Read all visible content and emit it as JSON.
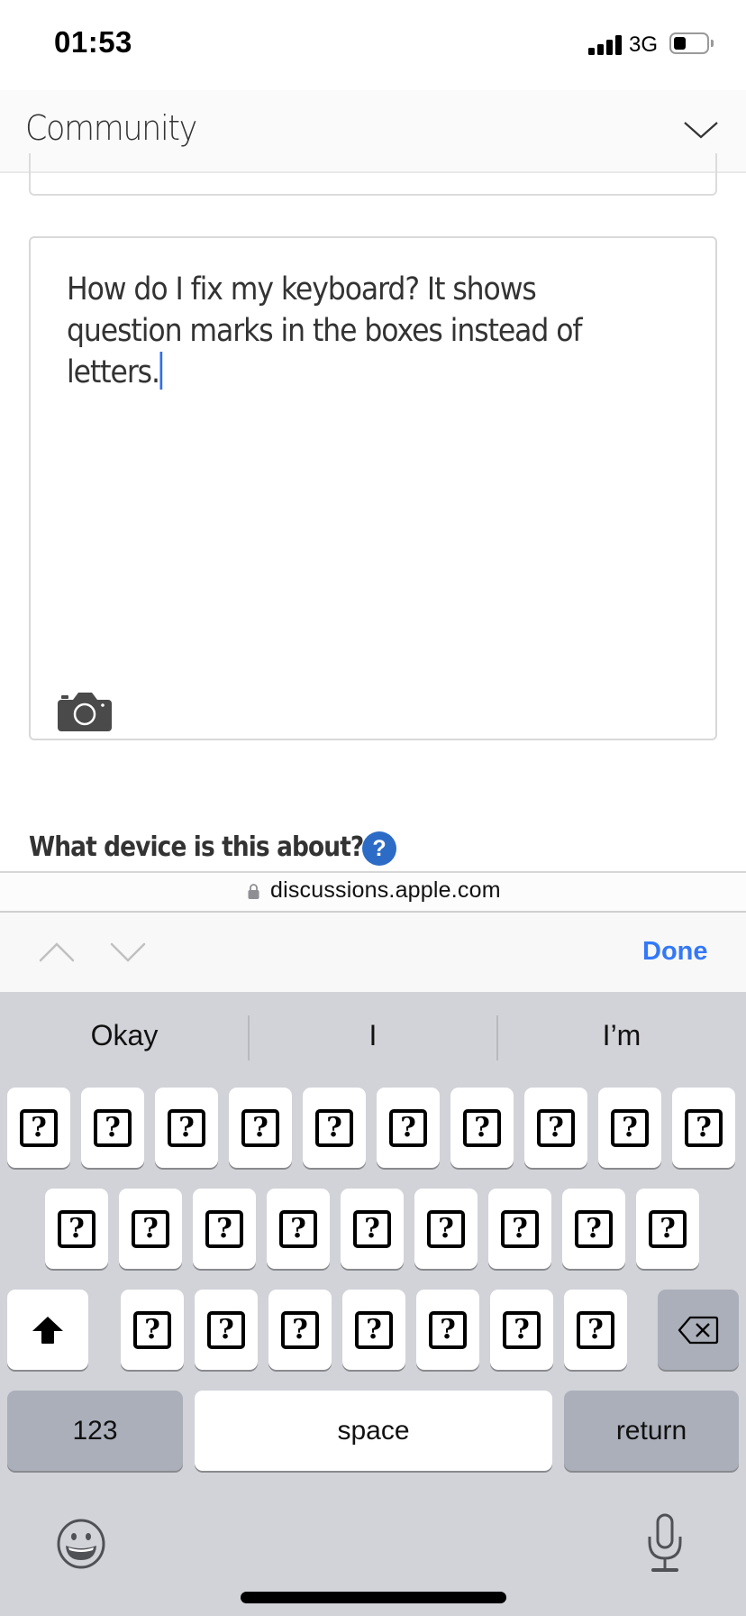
{
  "status_bar": {
    "time": "01:53",
    "network": "3G",
    "signal_bars": 4,
    "battery_level": 0.35
  },
  "header": {
    "title": "Community",
    "menu_icon": "chevron-down-icon"
  },
  "post_form": {
    "body_text": "How do I fix my keyboard? It shows question marks in the boxes instead of letters.",
    "attach_icon": "camera-icon",
    "device_question": "What device is this about?",
    "help_icon_label": "?"
  },
  "browser": {
    "url": "discussions.apple.com",
    "lock_icon": "lock-icon"
  },
  "form_toolbar": {
    "previous_icon": "chevron-up-icon",
    "next_icon": "chevron-down-icon",
    "done_label": "Done",
    "done_color": "#3478f6"
  },
  "keyboard": {
    "suggestions": [
      "Okay",
      "I",
      "I’m"
    ],
    "row1_keys": [
      "?",
      "?",
      "?",
      "?",
      "?",
      "?",
      "?",
      "?",
      "?",
      "?"
    ],
    "row2_keys": [
      "?",
      "?",
      "?",
      "?",
      "?",
      "?",
      "?",
      "?",
      "?"
    ],
    "row3_keys": [
      "?",
      "?",
      "?",
      "?",
      "?",
      "?",
      "?"
    ],
    "shift_icon": "shift-icon",
    "backspace_icon": "backspace-icon",
    "numbers_label": "123",
    "space_label": "space",
    "return_label": "return",
    "emoji_icon": "emoji-icon",
    "mic_icon": "microphone-icon"
  }
}
